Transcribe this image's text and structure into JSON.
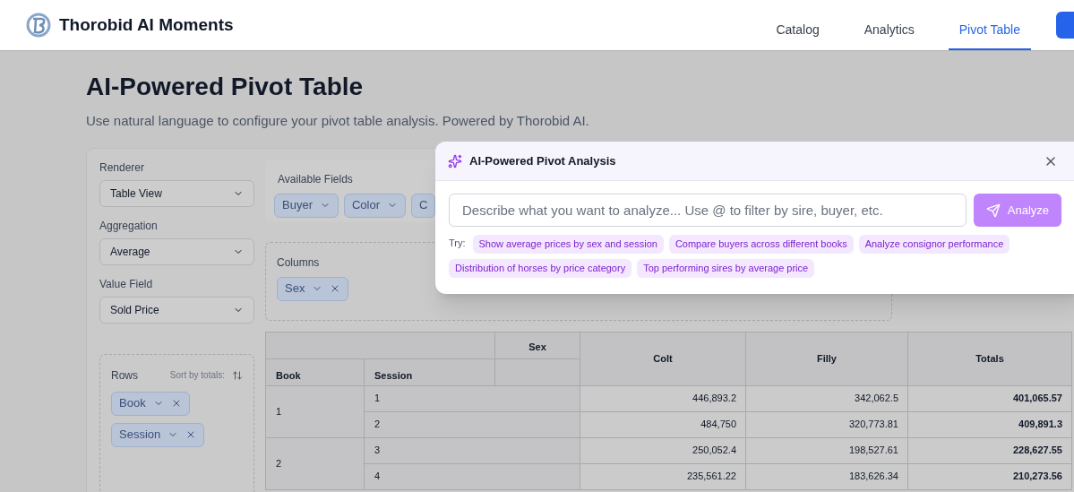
{
  "header": {
    "brand": "Thorobid AI Moments",
    "nav": [
      {
        "label": "Catalog",
        "selected": false
      },
      {
        "label": "Analytics",
        "selected": false
      },
      {
        "label": "Pivot Table",
        "selected": true
      }
    ]
  },
  "page": {
    "title": "AI-Powered Pivot Table",
    "subtitle": "Use natural language to configure your pivot table analysis. Powered by Thorobid AI."
  },
  "config": {
    "selects": [
      {
        "label": "Renderer",
        "value": "Table View"
      },
      {
        "label": "Aggregation",
        "value": "Average"
      },
      {
        "label": "Value Field",
        "value": "Sold Price"
      }
    ],
    "available_fields": {
      "label": "Available Fields",
      "fields": [
        "Buyer",
        "Color",
        "C"
      ]
    },
    "columns": {
      "label": "Columns",
      "fields": [
        "Sex"
      ]
    },
    "rows": {
      "label": "Rows",
      "sort_label": "Sort by totals:",
      "fields": [
        "Book",
        "Session"
      ]
    }
  },
  "table": {
    "column_field": "Sex",
    "row_fields": [
      "Book",
      "Session"
    ],
    "columns": [
      "Colt",
      "Filly",
      "Totals"
    ],
    "groups": [
      {
        "label": "1",
        "rows": [
          {
            "label": "1",
            "values": [
              "446,893.2",
              "342,062.5",
              "401,065.57"
            ]
          },
          {
            "label": "2",
            "values": [
              "484,750",
              "320,773.81",
              "409,891.3"
            ]
          }
        ]
      },
      {
        "label": "2",
        "rows": [
          {
            "label": "3",
            "values": [
              "250,052.4",
              "198,527.61",
              "228,627.55"
            ]
          },
          {
            "label": "4",
            "values": [
              "235,561.22",
              "183,626.34",
              "210,273.56"
            ]
          }
        ]
      }
    ]
  },
  "dialog": {
    "title": "AI-Powered Pivot Analysis",
    "placeholder": "Describe what you want to analyze... Use @ to filter by sire, buyer, etc.",
    "button": "Analyze",
    "try_label": "Try:",
    "suggestions": [
      "Show average prices by sex and session",
      "Compare buyers across different books",
      "Analyze consignor performance",
      "Distribution of horses by price category",
      "Top performing sires by average price"
    ]
  }
}
